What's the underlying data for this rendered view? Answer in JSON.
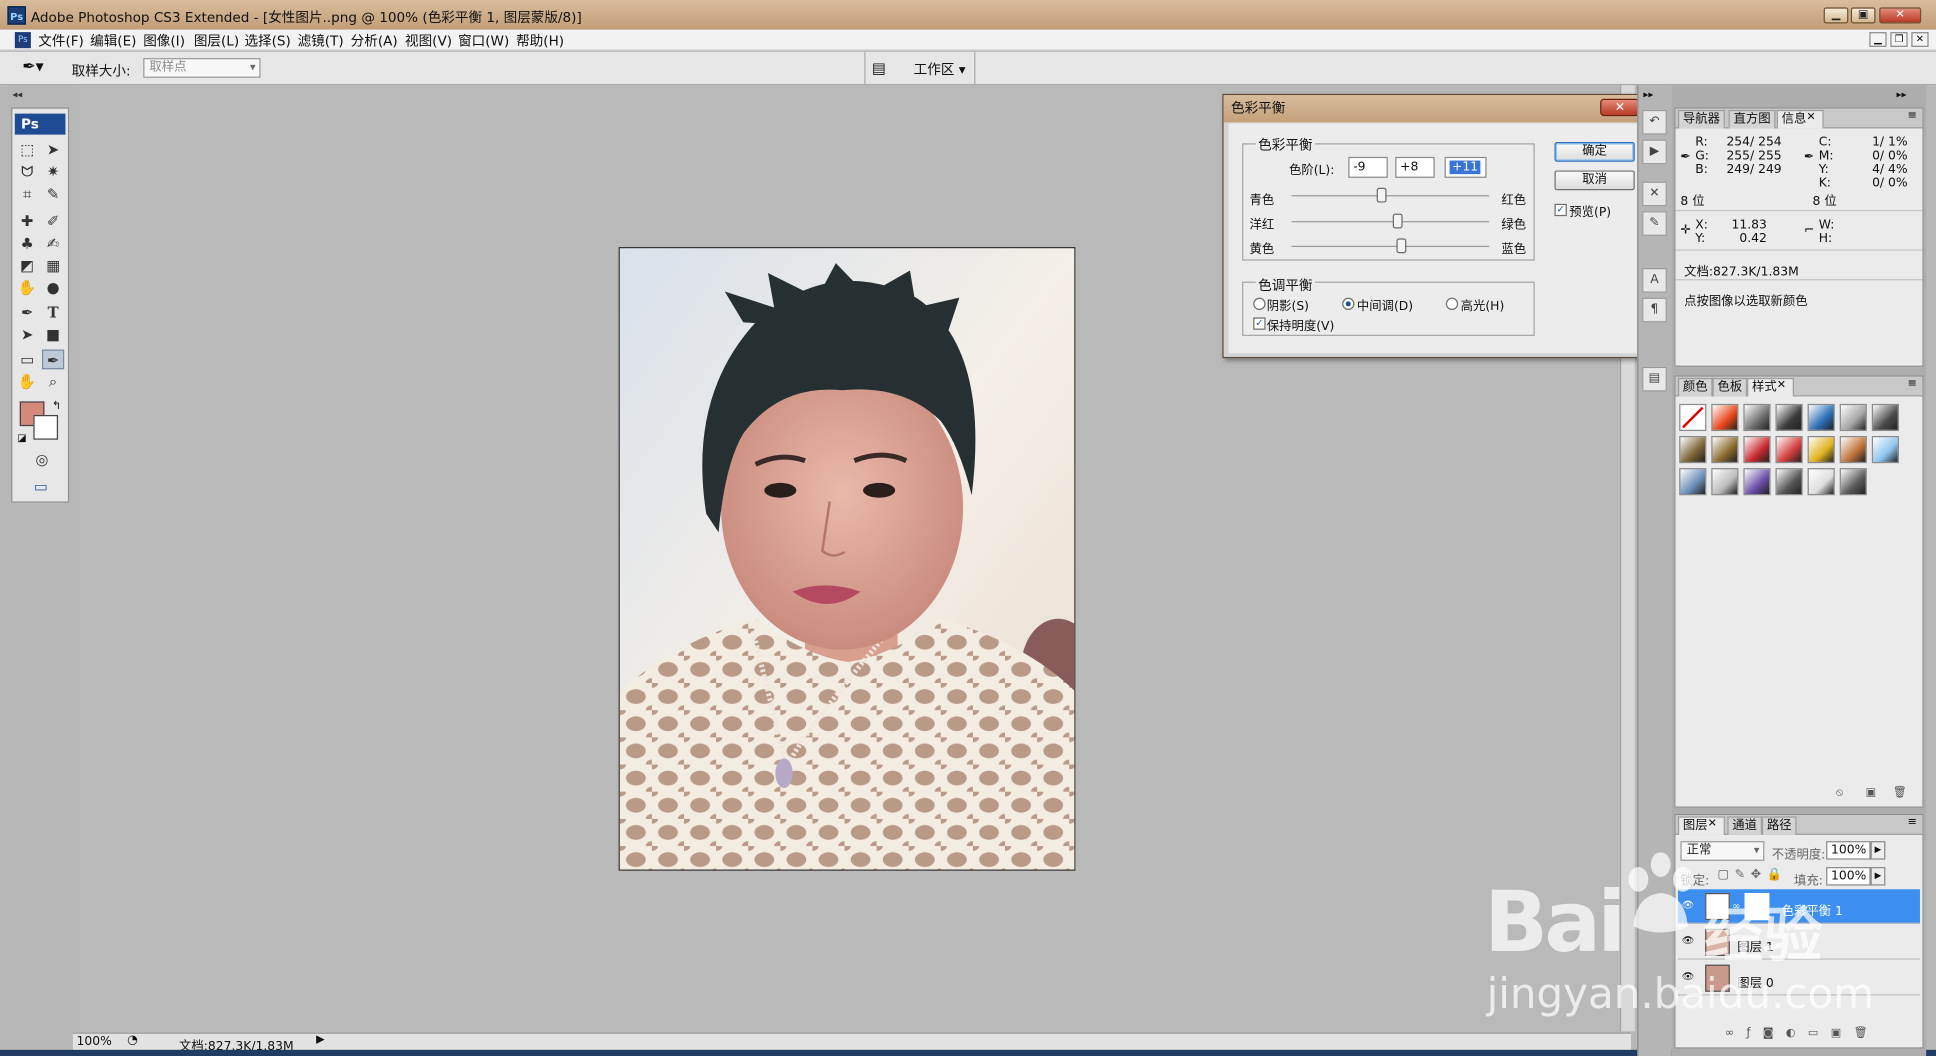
{
  "window": {
    "app_logo": "Ps",
    "title": "Adobe Photoshop CS3 Extended - [女性图片..png @ 100% (色彩平衡 1, 图层蒙版/8)]",
    "controls": [
      "minimize-icon",
      "maximize-icon",
      "close-icon"
    ]
  },
  "menu": {
    "items": [
      "文件(F)",
      "编辑(E)",
      "图像(I)",
      "图层(L)",
      "选择(S)",
      "滤镜(T)",
      "分析(A)",
      "视图(V)",
      "窗口(W)",
      "帮助(H)"
    ]
  },
  "options": {
    "sample_size_label": "取样大小:",
    "sample_size_value": "取样点",
    "workspace_label": "工作区 ▾"
  },
  "toolbox": {
    "logo": "Ps",
    "fg_color": "#d4897b",
    "bg_color": "#ffffff"
  },
  "status": {
    "zoom": "100%",
    "doc_info": "文档:827.3K/1.83M"
  },
  "color_balance": {
    "title": "色彩平衡",
    "section_title": "色彩平衡",
    "levels_label": "色阶(L):",
    "levels": [
      "-9",
      "+8",
      "+11"
    ],
    "sliders": [
      {
        "left": "青色",
        "right": "红色",
        "value": -9
      },
      {
        "left": "洋红",
        "right": "绿色",
        "value": 8
      },
      {
        "left": "黄色",
        "right": "蓝色",
        "value": 11
      }
    ],
    "tone_title": "色调平衡",
    "tones": [
      "阴影(S)",
      "中间调(D)",
      "高光(H)"
    ],
    "tone_selected": "中间调(D)",
    "preserve_label": "保持明度(V)",
    "preserve_checked": true,
    "ok_label": "确定",
    "cancel_label": "取消",
    "preview_label": "预览(P)",
    "preview_checked": true
  },
  "info_panel": {
    "tabs": [
      "导航器",
      "直方图",
      "信息"
    ],
    "active_tab": "信息",
    "rgb_labels": [
      "R:",
      "G:",
      "B:"
    ],
    "rgb_values": [
      "254/ 254",
      "255/ 255",
      "249/ 249"
    ],
    "cmyk_labels": [
      "C:",
      "M:",
      "Y:",
      "K:"
    ],
    "cmyk_values": [
      "1/  1%",
      "0/  0%",
      "4/  4%",
      "0/  0%"
    ],
    "bit_left": "8 位",
    "bit_right": "8 位",
    "xy_labels": [
      "X:",
      "Y:"
    ],
    "xy_values": [
      "11.83",
      "0.42"
    ],
    "wh_labels": [
      "W:",
      "H:"
    ],
    "doc": "文档:827.3K/1.83M",
    "hint": "点按图像以选取新颜色"
  },
  "styles_panel": {
    "tabs": [
      "颜色",
      "色板",
      "样式"
    ],
    "active_tab": "样式",
    "swatches": [
      "#ffffff",
      "#e8461a",
      "#6d6d6d",
      "#3a3a3a",
      "#2b6fb5",
      "#a5a5a5",
      "#4b4b4b",
      "#7c6436",
      "#8c6a2e",
      "#c8282e",
      "#d23c3c",
      "#e0b21e",
      "#c0733b",
      "#8ec4ee",
      "#6a8fb8",
      "#bbbbbb",
      "#6b4fa8",
      "#555555",
      "#dedede",
      "#5a5a5a"
    ]
  },
  "layers_panel": {
    "tabs": [
      "图层",
      "通道",
      "路径"
    ],
    "active_tab": "图层",
    "blend_mode": "正常",
    "opacity_label": "不透明度:",
    "opacity": "100%",
    "lock_label": "锁定:",
    "fill_label": "填充:",
    "fill": "100%",
    "layers": [
      {
        "name": "色彩平衡 1",
        "active": true
      },
      {
        "name": "图层 1",
        "active": false
      },
      {
        "name": "图层 0",
        "active": false
      }
    ]
  },
  "watermark": {
    "brand": "Bai",
    "brand2": "经验",
    "url": "jingyan.baidu.com"
  }
}
